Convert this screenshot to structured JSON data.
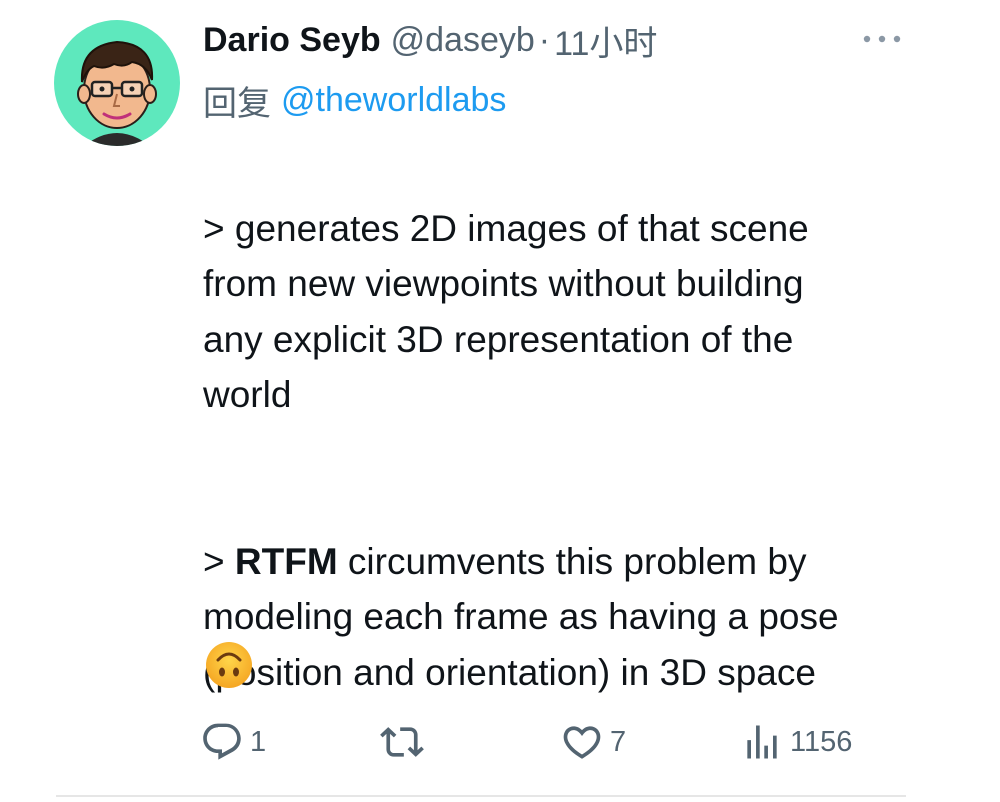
{
  "author": {
    "display_name": "Dario Seyb",
    "handle": "@daseyb",
    "separator": "·",
    "timestamp": "11小时"
  },
  "reply": {
    "prefix": "回复",
    "mention": "@theworldlabs"
  },
  "body": {
    "paragraph1": "> generates 2D images of that scene\nfrom new viewpoints without building\nany explicit 3D representation of the\nworld",
    "paragraph2_prefix": "> ",
    "paragraph2_bold": "RTFM",
    "paragraph2_rest": " circumvents this problem by\nmodeling each frame as having a pose\n(position and orientation) in 3D space",
    "emoji_name": "upside-down-face"
  },
  "actions": {
    "reply_count": "1",
    "retweet_count": "",
    "like_count": "7",
    "views_count": "1156"
  },
  "icons": {
    "avatar": "cartoon-avatar",
    "more": "more-horizontal-icon",
    "reply": "reply-icon",
    "retweet": "retweet-icon",
    "like": "heart-icon",
    "views": "views-bar-chart-icon"
  },
  "colors": {
    "text": "#0f1419",
    "secondary": "#536471",
    "link": "#1d9bf0",
    "avatar_bg": "#5ee8bd",
    "divider": "#e6e6e6"
  }
}
